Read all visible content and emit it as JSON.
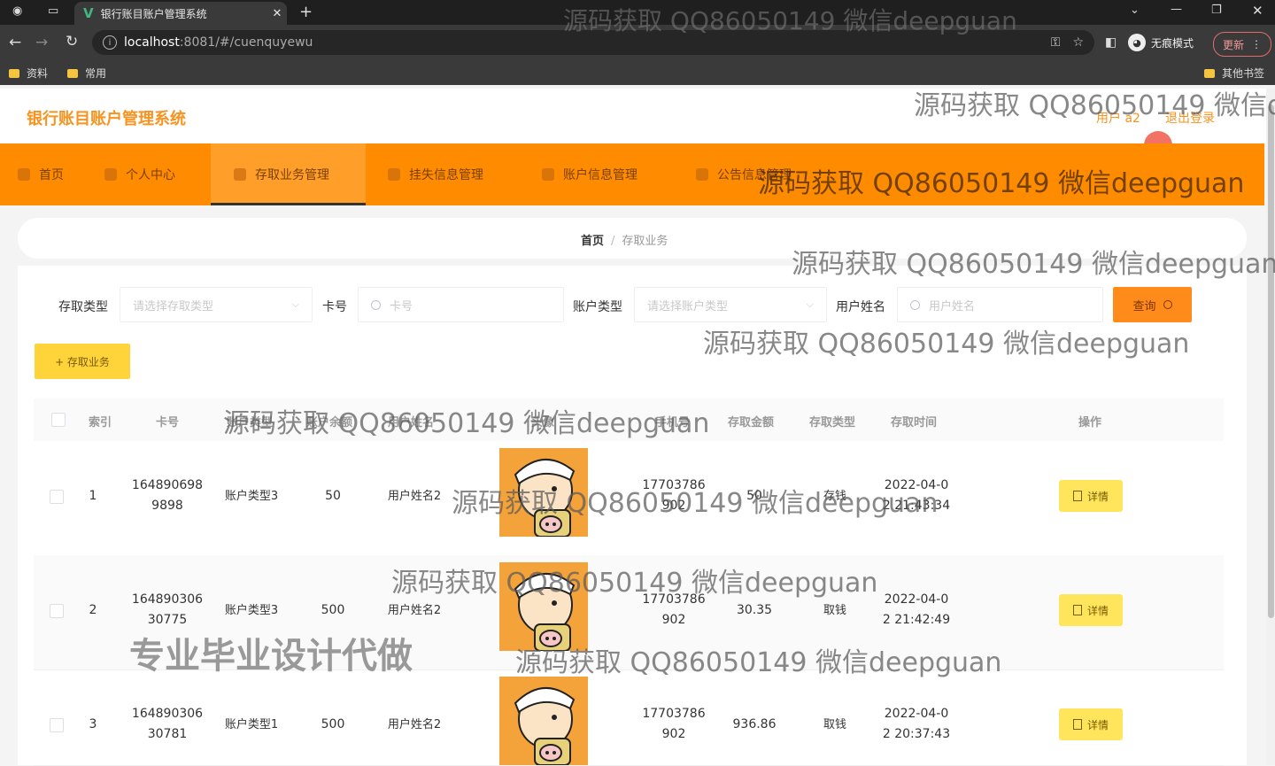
{
  "browser": {
    "tab_title": "银行账目账户管理系统",
    "url_host": "localhost",
    "url_path": ":8081/#/cuenquyewu",
    "incognito_label": "无痕模式",
    "update_label": "更新",
    "bookmarks": [
      "资料",
      "常用"
    ],
    "other_bookmarks": "其他书签"
  },
  "header": {
    "brand": "银行账目账户管理系统",
    "user": "用户 a2",
    "logout": "退出登录"
  },
  "nav": [
    {
      "label": "首页"
    },
    {
      "label": "个人中心"
    },
    {
      "label": "存取业务管理",
      "active": true
    },
    {
      "label": "挂失信息管理"
    },
    {
      "label": "账户信息管理"
    },
    {
      "label": "公告信息管理"
    }
  ],
  "breadcrumb": {
    "home": "首页",
    "current": "存取业务"
  },
  "filters": {
    "type_label": "存取类型",
    "type_placeholder": "请选择存取类型",
    "card_label": "卡号",
    "card_placeholder": "卡号",
    "acct_label": "账户类型",
    "acct_placeholder": "请选择账户类型",
    "name_label": "用户姓名",
    "name_placeholder": "用户姓名",
    "query_button": "查询",
    "add_button": "+ 存取业务"
  },
  "table": {
    "columns": [
      "索引",
      "卡号",
      "账户类型",
      "账户余额",
      "用户姓名",
      "头像",
      "手机号",
      "存取金额",
      "存取类型",
      "存取时间",
      "操作"
    ],
    "detail_button": "详情",
    "rows": [
      {
        "index": "1",
        "card_a": "164890698",
        "card_b": "9898",
        "acct": "账户类型3",
        "balance": "50",
        "name": "用户姓名2",
        "phone_a": "17703786",
        "phone_b": "902",
        "amount": "50",
        "type": "存钱",
        "time_a": "2022-04-0",
        "time_b": "2 21:43:34"
      },
      {
        "index": "2",
        "card_a": "164890306",
        "card_b": "30775",
        "acct": "账户类型3",
        "balance": "500",
        "name": "用户姓名2",
        "phone_a": "17703786",
        "phone_b": "902",
        "amount": "30.35",
        "type": "取钱",
        "time_a": "2022-04-0",
        "time_b": "2 21:42:49"
      },
      {
        "index": "3",
        "card_a": "164890306",
        "card_b": "30781",
        "acct": "账户类型1",
        "balance": "500",
        "name": "用户姓名2",
        "phone_a": "17703786",
        "phone_b": "902",
        "amount": "936.86",
        "type": "取钱",
        "time_a": "2022-04-0",
        "time_b": "2 20:37:43"
      }
    ]
  },
  "watermark": {
    "text": "源码获取 QQ86050149 微信deepguan",
    "text_cut": "源码获取 QQ86050149 微信d",
    "promo": "专业毕业设计代做"
  }
}
